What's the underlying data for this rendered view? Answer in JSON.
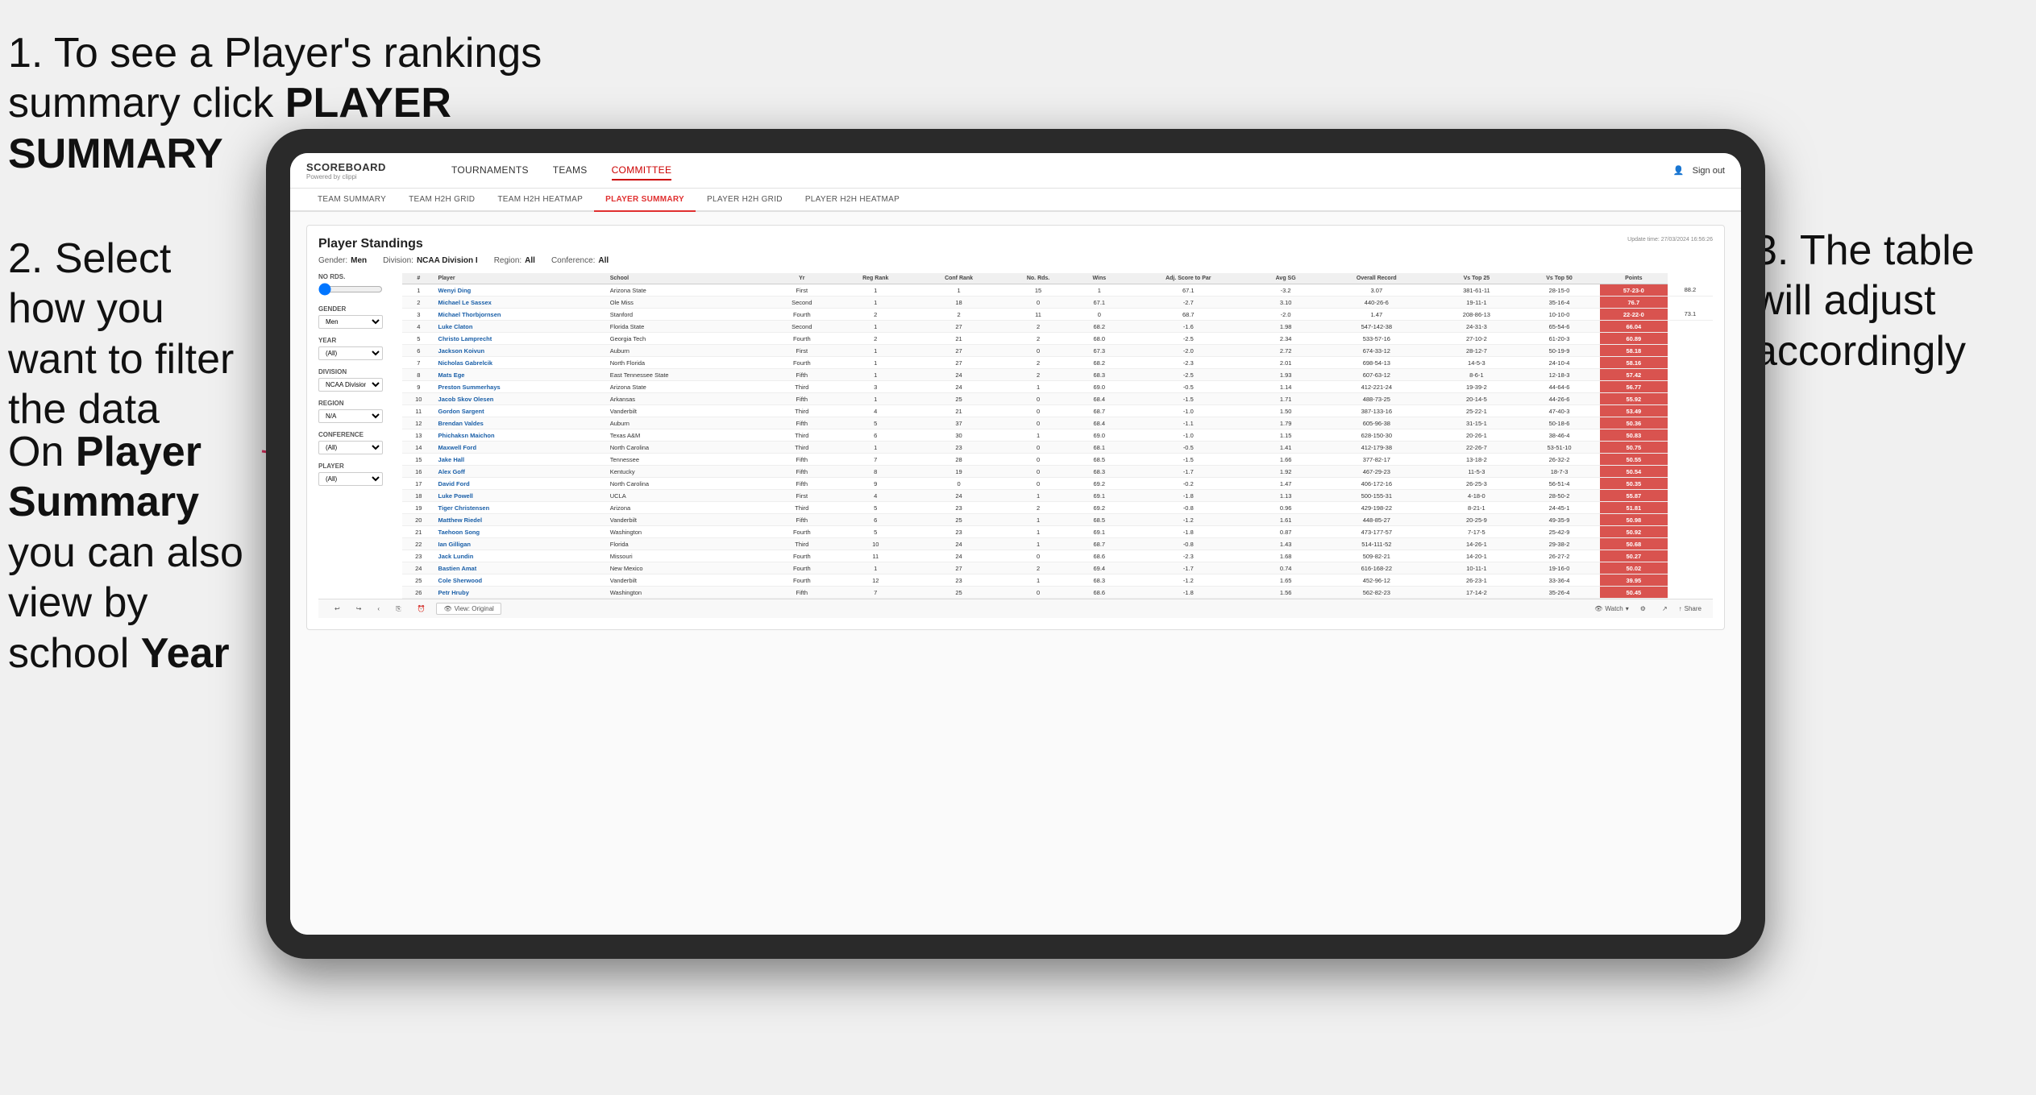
{
  "annotations": {
    "step1": "1. To see a Player's rankings summary click ",
    "step1_bold": "PLAYER SUMMARY",
    "step2_title": "2. Select how you want to filter the data",
    "step3": "3. The table will adjust accordingly",
    "bottom_note_prefix": "On ",
    "bottom_note_bold1": "Player Summary",
    "bottom_note_mid": " you can also view by school ",
    "bottom_note_bold2": "Year"
  },
  "nav": {
    "logo": "SCOREBOARD",
    "logo_sub": "Powered by clippi",
    "links": [
      "TOURNAMENTS",
      "TEAMS",
      "COMMITTEE"
    ],
    "sign_out": "Sign out",
    "sub_links": [
      "TEAM SUMMARY",
      "TEAM H2H GRID",
      "TEAM H2H HEATMAP",
      "PLAYER SUMMARY",
      "PLAYER H2H GRID",
      "PLAYER H2H HEATMAP"
    ]
  },
  "standings": {
    "title": "Player Standings",
    "update_time": "Update time: 27/03/2024 16:56:26",
    "filters": {
      "gender_label": "Gender:",
      "gender_value": "Men",
      "division_label": "Division:",
      "division_value": "NCAA Division I",
      "region_label": "Region:",
      "region_value": "All",
      "conference_label": "Conference:",
      "conference_value": "All"
    },
    "left_filters": {
      "no_rds_label": "No Rds.",
      "gender_label": "Gender",
      "gender_val": "Men",
      "year_label": "Year",
      "year_val": "(All)",
      "division_label": "Division",
      "division_val": "NCAA Division I",
      "region_label": "Region",
      "region_val": "N/A",
      "conference_label": "Conference",
      "conference_val": "(All)",
      "player_label": "Player",
      "player_val": "(All)"
    },
    "columns": [
      "#",
      "Player",
      "School",
      "Yr",
      "Reg Rank",
      "Conf Rank",
      "No. Rds.",
      "Wins",
      "Adj. Score to Par",
      "Avg SG",
      "Overall Record",
      "Vs Top 25",
      "Vs Top 50",
      "Points"
    ],
    "rows": [
      [
        1,
        "Wenyi Ding",
        "Arizona State",
        "First",
        1,
        1,
        15,
        1,
        "67.1",
        "-3.2",
        "3.07",
        "381-61-11",
        "28-15-0",
        "57-23-0",
        "88.2"
      ],
      [
        2,
        "Michael Le Sassex",
        "Ole Miss",
        "Second",
        1,
        18,
        0,
        "67.1",
        "-2.7",
        "3.10",
        "440-26-6",
        "19-11-1",
        "35-16-4",
        "76.7"
      ],
      [
        3,
        "Michael Thorbjornsen",
        "Stanford",
        "Fourth",
        2,
        2,
        11,
        0,
        "68.7",
        "-2.0",
        "1.47",
        "208-86-13",
        "10-10-0",
        "22-22-0",
        "73.1"
      ],
      [
        4,
        "Luke Claton",
        "Florida State",
        "Second",
        1,
        27,
        2,
        "68.2",
        "-1.6",
        "1.98",
        "547-142-38",
        "24-31-3",
        "65-54-6",
        "66.04"
      ],
      [
        5,
        "Christo Lamprecht",
        "Georgia Tech",
        "Fourth",
        2,
        21,
        2,
        "68.0",
        "-2.5",
        "2.34",
        "533-57-16",
        "27-10-2",
        "61-20-3",
        "60.89"
      ],
      [
        6,
        "Jackson Koivun",
        "Auburn",
        "First",
        1,
        27,
        0,
        "67.3",
        "-2.0",
        "2.72",
        "674-33-12",
        "28-12-7",
        "50-19-9",
        "58.18"
      ],
      [
        7,
        "Nicholas Gabrelcik",
        "North Florida",
        "Fourth",
        1,
        27,
        2,
        "68.2",
        "-2.3",
        "2.01",
        "698-54-13",
        "14-5-3",
        "24-10-4",
        "58.16"
      ],
      [
        8,
        "Mats Ege",
        "East Tennessee State",
        "Fifth",
        1,
        24,
        2,
        "68.3",
        "-2.5",
        "1.93",
        "607-63-12",
        "8-6-1",
        "12-18-3",
        "57.42"
      ],
      [
        9,
        "Preston Summerhays",
        "Arizona State",
        "Third",
        3,
        24,
        1,
        "69.0",
        "-0.5",
        "1.14",
        "412-221-24",
        "19-39-2",
        "44-64-6",
        "56.77"
      ],
      [
        10,
        "Jacob Skov Olesen",
        "Arkansas",
        "Fifth",
        1,
        25,
        0,
        "68.4",
        "-1.5",
        "1.71",
        "488-73-25",
        "20-14-5",
        "44-26-6",
        "55.92"
      ],
      [
        11,
        "Gordon Sargent",
        "Vanderbilt",
        "Third",
        4,
        21,
        0,
        "68.7",
        "-1.0",
        "1.50",
        "387-133-16",
        "25-22-1",
        "47-40-3",
        "53.49"
      ],
      [
        12,
        "Brendan Valdes",
        "Auburn",
        "Fifth",
        5,
        37,
        0,
        "68.4",
        "-1.1",
        "1.79",
        "605-96-38",
        "31-15-1",
        "50-18-6",
        "50.36"
      ],
      [
        13,
        "Phichaksn Maichon",
        "Texas A&M",
        "Third",
        6,
        30,
        1,
        "69.0",
        "-1.0",
        "1.15",
        "628-150-30",
        "20-26-1",
        "38-46-4",
        "50.83"
      ],
      [
        14,
        "Maxwell Ford",
        "North Carolina",
        "Third",
        1,
        23,
        0,
        "68.1",
        "-0.5",
        "1.41",
        "412-179-38",
        "22-26-7",
        "53-51-10",
        "50.75"
      ],
      [
        15,
        "Jake Hall",
        "Tennessee",
        "Fifth",
        7,
        28,
        0,
        "68.5",
        "-1.5",
        "1.66",
        "377-82-17",
        "13-18-2",
        "26-32-2",
        "50.55"
      ],
      [
        16,
        "Alex Goff",
        "Kentucky",
        "Fifth",
        8,
        19,
        0,
        "68.3",
        "-1.7",
        "1.92",
        "467-29-23",
        "11-5-3",
        "18-7-3",
        "50.54"
      ],
      [
        17,
        "David Ford",
        "North Carolina",
        "Fifth",
        9,
        0,
        0,
        "69.2",
        "-0.2",
        "1.47",
        "406-172-16",
        "26-25-3",
        "56-51-4",
        "50.35"
      ],
      [
        18,
        "Luke Powell",
        "UCLA",
        "First",
        4,
        24,
        1,
        "69.1",
        "-1.8",
        "1.13",
        "500-155-31",
        "4-18-0",
        "28-50-2",
        "55.87"
      ],
      [
        19,
        "Tiger Christensen",
        "Arizona",
        "Third",
        5,
        23,
        2,
        "69.2",
        "-0.8",
        "0.96",
        "429-198-22",
        "8-21-1",
        "24-45-1",
        "51.81"
      ],
      [
        20,
        "Matthew Riedel",
        "Vanderbilt",
        "Fifth",
        6,
        25,
        1,
        "68.5",
        "-1.2",
        "1.61",
        "448-85-27",
        "20-25-9",
        "49-35-9",
        "50.98"
      ],
      [
        21,
        "Taehoon Song",
        "Washington",
        "Fourth",
        5,
        23,
        1,
        "69.1",
        "-1.8",
        "0.87",
        "473-177-57",
        "7-17-5",
        "25-42-9",
        "50.92"
      ],
      [
        22,
        "Ian Gilligan",
        "Florida",
        "Third",
        10,
        24,
        1,
        "68.7",
        "-0.8",
        "1.43",
        "514-111-52",
        "14-26-1",
        "29-38-2",
        "50.68"
      ],
      [
        23,
        "Jack Lundin",
        "Missouri",
        "Fourth",
        11,
        24,
        0,
        "68.6",
        "-2.3",
        "1.68",
        "509-82-21",
        "14-20-1",
        "26-27-2",
        "50.27"
      ],
      [
        24,
        "Bastien Amat",
        "New Mexico",
        "Fourth",
        1,
        27,
        2,
        "69.4",
        "-1.7",
        "0.74",
        "616-168-22",
        "10-11-1",
        "19-16-0",
        "50.02"
      ],
      [
        25,
        "Cole Sherwood",
        "Vanderbilt",
        "Fourth",
        12,
        23,
        1,
        "68.3",
        "-1.2",
        "1.65",
        "452-96-12",
        "26-23-1",
        "33-36-4",
        "39.95"
      ],
      [
        26,
        "Petr Hruby",
        "Washington",
        "Fifth",
        7,
        25,
        0,
        "68.6",
        "-1.8",
        "1.56",
        "562-82-23",
        "17-14-2",
        "35-26-4",
        "50.45"
      ]
    ]
  },
  "toolbar": {
    "view_label": "View: Original",
    "watch_label": "Watch",
    "share_label": "Share"
  }
}
